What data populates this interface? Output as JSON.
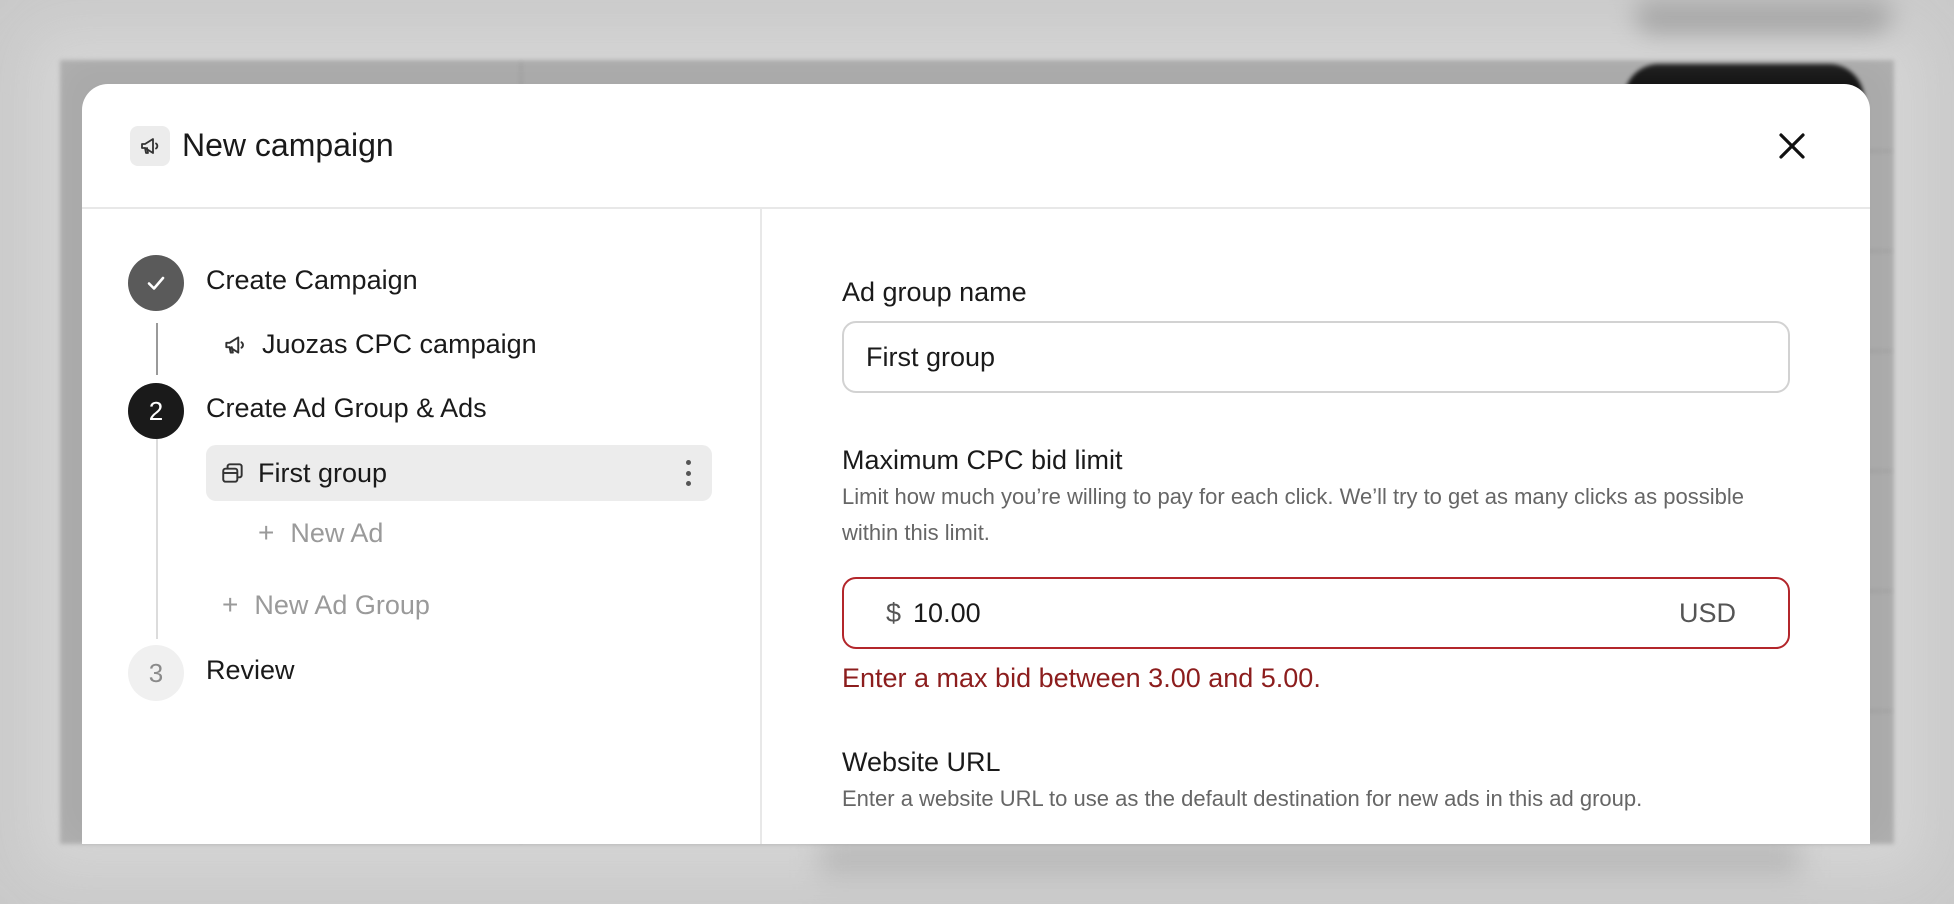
{
  "modal": {
    "title": "New campaign",
    "icon": "megaphone-icon",
    "close_icon": "close-icon"
  },
  "steps": [
    {
      "number": "✓",
      "label": "Create Campaign",
      "status": "done"
    },
    {
      "number": "2",
      "label": "Create Ad Group & Ads",
      "status": "active"
    },
    {
      "number": "3",
      "label": "Review",
      "status": "pending"
    }
  ],
  "campaign_item": {
    "label": "Juozas CPC campaign",
    "icon": "megaphone-icon"
  },
  "ad_group_item": {
    "label": "First group",
    "icon": "ad-group-icon"
  },
  "new_ad_label": "New Ad",
  "new_ad_group_label": "New Ad Group",
  "form": {
    "ad_group_name": {
      "label": "Ad group name",
      "value": "First group"
    },
    "max_cpc": {
      "label": "Maximum CPC bid limit",
      "help": "Limit how much you’re willing to pay for each click. We’ll try to get as many clicks as possible within this limit.",
      "currency_symbol": "$",
      "value": "10.00",
      "unit": "USD",
      "error": "Enter a max bid between 3.00 and 5.00."
    },
    "website_url": {
      "label": "Website URL",
      "help": "Enter a website URL to use as the default destination for new ads in this ad group."
    }
  },
  "colors": {
    "error": "#b3262b",
    "error_text": "#8c1d1d",
    "active_step": "#1a1a1a",
    "done_step": "#5a5a5a"
  }
}
